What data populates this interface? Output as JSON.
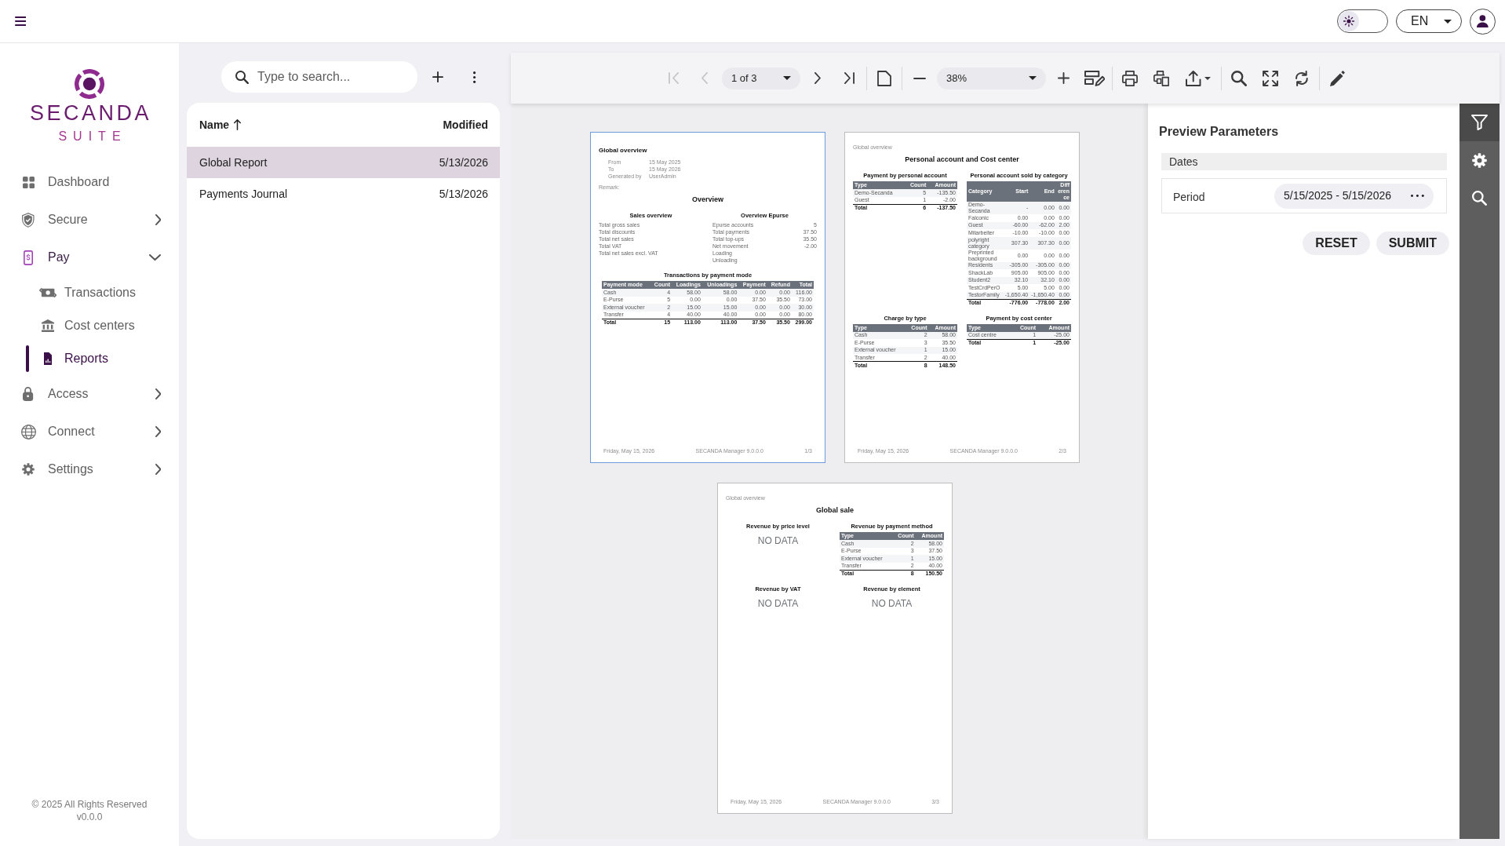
{
  "top_bar": {
    "theme_switch": {
      "on": false
    },
    "language": "EN"
  },
  "sidebar": {
    "logo": {
      "name": "SECANDA",
      "tagline": "SUITE"
    },
    "items": [
      {
        "kind": "link",
        "label": "Dashboard",
        "selected": false
      },
      {
        "kind": "group",
        "label": "Secure",
        "selected": false,
        "expanded": false
      },
      {
        "kind": "group",
        "label": "Pay",
        "selected": false,
        "expanded": true,
        "children": [
          {
            "kind": "link",
            "label": "Transactions",
            "selected": false
          },
          {
            "kind": "link",
            "label": "Cost centers",
            "selected": false
          },
          {
            "kind": "link",
            "label": "Reports",
            "selected": true
          }
        ]
      },
      {
        "kind": "group",
        "label": "Access",
        "selected": false,
        "expanded": false
      },
      {
        "kind": "group",
        "label": "Connect",
        "selected": false,
        "expanded": false
      },
      {
        "kind": "group",
        "label": "Settings",
        "selected": false,
        "expanded": false
      }
    ],
    "footer": {
      "copyright": "© 2025 All Rights Reserved",
      "version": "v0.0.0"
    }
  },
  "report_list": {
    "search": {
      "placeholder": "Type to search..."
    },
    "columns": [
      {
        "label": "Name",
        "sorted": true
      },
      {
        "label": "Modified",
        "sorted": false
      }
    ],
    "rows": [
      {
        "name": "Global Report",
        "modified": "5/13/2026",
        "selected": true
      },
      {
        "name": "Payments Journal",
        "modified": "5/13/2026",
        "selected": false
      }
    ]
  },
  "viewer": {
    "toolbar": [
      {
        "kind": "button",
        "disabled": true
      },
      {
        "kind": "button",
        "disabled": true
      },
      {
        "kind": "select",
        "value": "1 of 3"
      },
      {
        "kind": "button",
        "disabled": false
      },
      {
        "kind": "button",
        "disabled": false
      },
      {
        "kind": "separator"
      },
      {
        "kind": "button",
        "disabled": false
      },
      {
        "kind": "separator"
      },
      {
        "kind": "button",
        "disabled": false
      },
      {
        "kind": "select",
        "value": "38%"
      },
      {
        "kind": "button",
        "disabled": false
      },
      {
        "kind": "button",
        "disabled": false
      },
      {
        "kind": "separator"
      },
      {
        "kind": "button",
        "disabled": false
      },
      {
        "kind": "button",
        "disabled": false
      },
      {
        "kind": "menu_button",
        "disabled": false
      },
      {
        "kind": "separator"
      },
      {
        "kind": "button",
        "disabled": false
      },
      {
        "kind": "button",
        "disabled": false
      },
      {
        "kind": "button",
        "disabled": false
      },
      {
        "kind": "separator"
      },
      {
        "kind": "button",
        "disabled": false
      }
    ],
    "pages": [
      {
        "selected": true,
        "blocks": [
          {
            "kind": "report_title",
            "text": "Global overview"
          },
          {
            "kind": "meta",
            "rows": [
              {
                "label": "From",
                "value": "15 May 2025"
              },
              {
                "label": "To",
                "value": "15 May 2026"
              },
              {
                "label": "Generated by",
                "value": "UserAdmin"
              }
            ]
          },
          {
            "kind": "label",
            "text": "Remark:"
          },
          {
            "kind": "title",
            "text": "Overview"
          },
          {
            "kind": "sections",
            "items": [
              {
                "kind": "list",
                "title": "Sales overview",
                "rows": [
                  {
                    "label": "Total gross sales"
                  },
                  {
                    "label": "Total discounts"
                  },
                  {
                    "label": "Total net sales"
                  },
                  {
                    "label": "Total VAT"
                  },
                  {
                    "label": "Total net sales excl. VAT"
                  }
                ]
              },
              {
                "kind": "list",
                "title": "Overview Epurse",
                "rows": [
                  {
                    "label": "Epurse accounts",
                    "value": "5"
                  },
                  {
                    "label": "Total payments",
                    "value": "37.50"
                  },
                  {
                    "label": "Total top-ups",
                    "value": "35.50"
                  },
                  {
                    "label": "Net movement",
                    "value": "-2.00"
                  },
                  {
                    "label": "Loading"
                  },
                  {
                    "label": "Unloading"
                  }
                ]
              }
            ]
          },
          {
            "kind": "sections",
            "items": [
              {
                "kind": "table",
                "title": "Transactions by payment mode",
                "columns": [
                  "Payment mode",
                  "Count",
                  "Loadings",
                  "Unloadings",
                  "Payment",
                  "Refund",
                  "Total"
                ],
                "rows": [
                  [
                    "Cash",
                    "4",
                    "58.00",
                    "58.00",
                    "0.00",
                    "0.00",
                    "116.00"
                  ],
                  [
                    "E-Purse",
                    "5",
                    "0.00",
                    "0.00",
                    "37.50",
                    "35.50",
                    "73.00"
                  ],
                  [
                    "External voucher",
                    "2",
                    "15.00",
                    "15.00",
                    "0.00",
                    "0.00",
                    "30.00"
                  ],
                  [
                    "Transfer",
                    "4",
                    "40.00",
                    "40.00",
                    "0.00",
                    "0.00",
                    "80.00"
                  ]
                ],
                "total": [
                  "Total",
                  "15",
                  "113.00",
                  "113.00",
                  "37.50",
                  "35.50",
                  "299.00"
                ]
              }
            ]
          }
        ],
        "footer": [
          "Friday, May 15, 2026",
          "SECANDA Manager 9.0.0.0",
          "1/3"
        ]
      },
      {
        "selected": false,
        "blocks": [
          {
            "kind": "running_header",
            "text": "Global overview"
          },
          {
            "kind": "title",
            "text": "Personal account and Cost center"
          },
          {
            "kind": "sections",
            "items": [
              {
                "kind": "table",
                "title": "Payment by personal account",
                "columns": [
                  "Type",
                  "Count",
                  "Amount"
                ],
                "rows": [
                  [
                    "Demo-Secanda",
                    "5",
                    "-135.50"
                  ],
                  [
                    "Guest",
                    "1",
                    "-2.00"
                  ]
                ],
                "total": [
                  "Total",
                  "6",
                  "-137.50"
                ]
              },
              {
                "kind": "table",
                "title": "Personal account sold by category",
                "columns": [
                  "Category",
                  "Start",
                  "End",
                  "Difference"
                ],
                "rows": [
                  [
                    "Demo-Secanda",
                    "-",
                    "0.00",
                    "0.00"
                  ],
                  [
                    "Falconic",
                    "0.00",
                    "0.00",
                    "0.00"
                  ],
                  [
                    "Guest",
                    "-60.00",
                    "-62.00",
                    "2.00"
                  ],
                  [
                    "Mitarbeiter",
                    "-10.00",
                    "-10.00",
                    "0.00"
                  ],
                  [
                    "polyright category",
                    "307.30",
                    "307.30",
                    "0.00"
                  ],
                  [
                    "Preprinted background",
                    "0.00",
                    "0.00",
                    "0.00"
                  ],
                  [
                    "Residents",
                    "-305.00",
                    "-305.00",
                    "0.00"
                  ],
                  [
                    "ShackLab",
                    "905.00",
                    "905.00",
                    "0.00"
                  ],
                  [
                    "Student2",
                    "32.10",
                    "32.10",
                    "0.00"
                  ],
                  [
                    "TestCrdPerO",
                    "5.00",
                    "5.00",
                    "0.00"
                  ],
                  [
                    "TestorFamily",
                    "-1,650.40",
                    "-1,650.40",
                    "0.00"
                  ]
                ],
                "total": [
                  "Total",
                  "-776.00",
                  "-778.00",
                  "2.00"
                ]
              }
            ]
          },
          {
            "kind": "sections",
            "items": [
              {
                "kind": "table",
                "title": "Charge by type",
                "columns": [
                  "Type",
                  "Count",
                  "Amount"
                ],
                "rows": [
                  [
                    "Cash",
                    "2",
                    "58.00"
                  ],
                  [
                    "E-Purse",
                    "3",
                    "35.50"
                  ],
                  [
                    "External voucher",
                    "1",
                    "15.00"
                  ],
                  [
                    "Transfer",
                    "2",
                    "40.00"
                  ]
                ],
                "total": [
                  "Total",
                  "8",
                  "148.50"
                ]
              },
              {
                "kind": "table",
                "title": "Payment by cost center",
                "columns": [
                  "Type",
                  "Count",
                  "Amount"
                ],
                "rows": [
                  [
                    "Cost centre",
                    "1",
                    "-25.00"
                  ]
                ],
                "total": [
                  "Total",
                  "1",
                  "-25.00"
                ]
              }
            ]
          }
        ],
        "footer": [
          "Friday, May 15, 2026",
          "SECANDA Manager 9.0.0.0",
          "2/3"
        ]
      },
      {
        "selected": false,
        "blocks": [
          {
            "kind": "running_header",
            "text": "Global overview"
          },
          {
            "kind": "title",
            "text": "Global sale"
          },
          {
            "kind": "sections",
            "items": [
              {
                "kind": "no_data",
                "title": "Revenue by price level",
                "text": "NO DATA"
              },
              {
                "kind": "table",
                "title": "Revenue by payment method",
                "columns": [
                  "Type",
                  "Count",
                  "Amount"
                ],
                "rows": [
                  [
                    "Cash",
                    "2",
                    "58.00"
                  ],
                  [
                    "E-Purse",
                    "3",
                    "37.50"
                  ],
                  [
                    "External voucher",
                    "1",
                    "15.00"
                  ],
                  [
                    "Transfer",
                    "2",
                    "40.00"
                  ]
                ],
                "total": [
                  "Total",
                  "8",
                  "150.50"
                ]
              }
            ]
          },
          {
            "kind": "sections",
            "items": [
              {
                "kind": "no_data",
                "title": "Revenue by VAT",
                "text": "NO DATA"
              },
              {
                "kind": "no_data",
                "title": "Revenue by element",
                "text": "NO DATA"
              }
            ]
          }
        ],
        "footer": [
          "Friday, May 15, 2026",
          "SECANDA Manager 9.0.0.0",
          "3/3"
        ]
      }
    ],
    "parameters_panel": {
      "title": "Preview Parameters",
      "groups": [
        {
          "title": "Dates",
          "fields": [
            {
              "label": "Period",
              "value": "5/15/2025 - 5/15/2026"
            }
          ]
        }
      ],
      "buttons": [
        "RESET",
        "SUBMIT"
      ]
    },
    "side_tabs": [
      {
        "selected": true
      },
      {
        "selected": false
      },
      {
        "selected": false
      }
    ]
  }
}
